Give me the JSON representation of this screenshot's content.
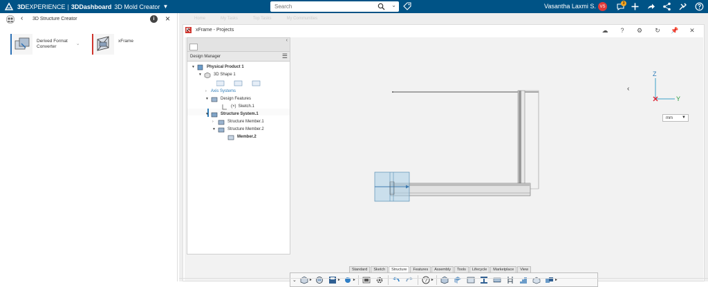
{
  "topbar": {
    "brand_prefix": "3D",
    "brand_name": "EXPERIENCE",
    "brand_divider": "|",
    "dashboard": "3DDashboard",
    "app_name": "3D Mold Creator",
    "search_placeholder": "Search",
    "user_name": "Vasantha Laxmi S.",
    "avatar_initials": "VS",
    "notification_count": "3",
    "bg_color": "#005386"
  },
  "left_panel": {
    "title": "3D Structure Creator",
    "apps": [
      {
        "label_line1": "Derived Format",
        "label_line2": "Converter",
        "accent": "#2a6fb5"
      },
      {
        "label_line1": "xFrame",
        "label_line2": "",
        "accent": "#d0342c"
      }
    ]
  },
  "app_frame": {
    "title": "xFrame - Projects",
    "ghost_tabs": [
      "Home",
      "My Tasks",
      "Top Tasks",
      "My Communities"
    ]
  },
  "tree": {
    "header": "Design Manager",
    "nodes": [
      {
        "label": "Physical Product 1"
      },
      {
        "label": "3D Shape 1"
      },
      {
        "label": "Axis Systems"
      },
      {
        "label": "Design Features"
      },
      {
        "label": "Sketch.1"
      },
      {
        "label": "Structure System.1"
      },
      {
        "label": "Structure Member.1"
      },
      {
        "label": "Structure Member.2"
      },
      {
        "label": "Member.2"
      }
    ]
  },
  "viewport": {
    "axis_labels": {
      "z": "Z",
      "y": "Y"
    },
    "units": "mm"
  },
  "toolbar": {
    "tabs": [
      "Standard",
      "Sketch",
      "Structure",
      "Features",
      "Assembly",
      "Tools",
      "Lifecycle",
      "Marketplace",
      "View"
    ],
    "active_tab": "Structure",
    "icons": [
      "model-icon",
      "rotate-part-icon",
      "save-icon",
      "update-icon",
      "snapshot-icon",
      "settings-icon",
      "undo-icon",
      "redo-icon",
      "help-icon",
      "structure-box-icon",
      "structure-face-icon",
      "structure-plate-icon",
      "beam-icon",
      "member-icon",
      "ladder-icon",
      "stair-icon",
      "railing-icon",
      "assembly-icon"
    ]
  }
}
